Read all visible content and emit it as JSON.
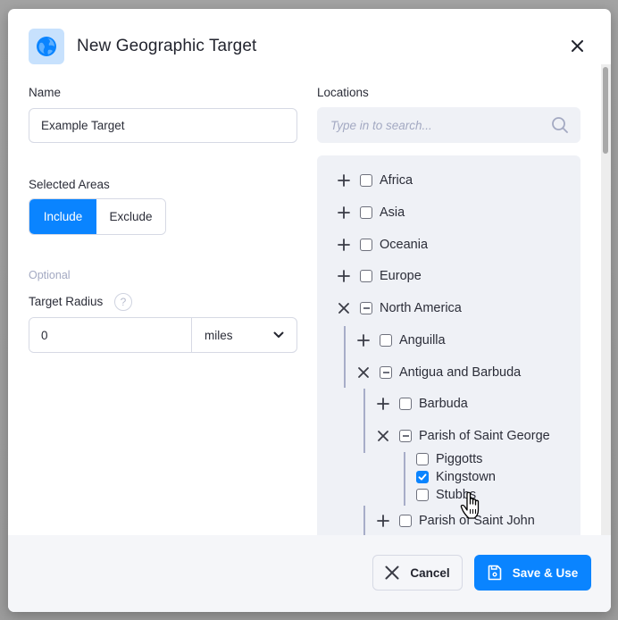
{
  "modal": {
    "title": "New Geographic Target",
    "icon": "globe-icon",
    "close_icon": "close-icon"
  },
  "form": {
    "name_label": "Name",
    "name_value": "Example Target",
    "selected_areas_label": "Selected Areas",
    "selected_areas_options": [
      "Include",
      "Exclude"
    ],
    "selected_areas_active": "Include",
    "optional_label": "Optional",
    "target_radius_label": "Target Radius",
    "help_glyph": "?",
    "radius_value": "0",
    "radius_unit": "miles"
  },
  "locations": {
    "label": "Locations",
    "search_placeholder": "Type in to search...",
    "search_value": "",
    "tree": [
      {
        "label": "Africa",
        "toggle": "expand",
        "state": "unchecked",
        "depth": 0
      },
      {
        "label": "Asia",
        "toggle": "expand",
        "state": "unchecked",
        "depth": 0
      },
      {
        "label": "Oceania",
        "toggle": "expand",
        "state": "unchecked",
        "depth": 0
      },
      {
        "label": "Europe",
        "toggle": "expand",
        "state": "unchecked",
        "depth": 0
      },
      {
        "label": "North America",
        "toggle": "collapse",
        "state": "partial",
        "depth": 0
      },
      {
        "label": "Anguilla",
        "toggle": "expand",
        "state": "unchecked",
        "depth": 1
      },
      {
        "label": "Antigua and Barbuda",
        "toggle": "collapse",
        "state": "partial",
        "depth": 1
      },
      {
        "label": "Barbuda",
        "toggle": "expand",
        "state": "unchecked",
        "depth": 2
      },
      {
        "label": "Parish of Saint George",
        "toggle": "collapse",
        "state": "partial",
        "depth": 2
      },
      {
        "label": "Piggotts",
        "toggle": "none",
        "state": "unchecked",
        "depth": 3
      },
      {
        "label": "Kingstown",
        "toggle": "none",
        "state": "checked",
        "depth": 3
      },
      {
        "label": "Stubbs",
        "toggle": "none",
        "state": "unchecked",
        "depth": 3
      },
      {
        "label": "Parish of Saint John",
        "toggle": "expand",
        "state": "unchecked",
        "depth": 2
      }
    ]
  },
  "footer": {
    "cancel_label": "Cancel",
    "save_label": "Save & Use"
  },
  "colors": {
    "accent": "#0a84ff",
    "icon_bg": "#c7e1fd",
    "panel_bg": "#eff1f6",
    "footer_bg": "#f5f6f9"
  }
}
